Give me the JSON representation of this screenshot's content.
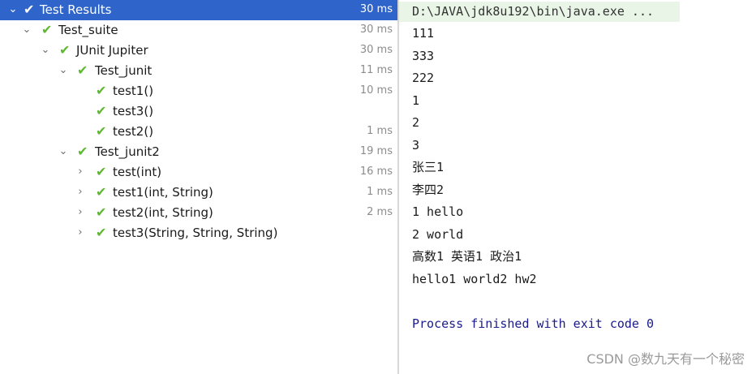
{
  "tree": [
    {
      "label": "Test Results",
      "time": "30 ms",
      "selected": true,
      "chevron": "down"
    },
    {
      "label": "Test_suite",
      "time": "30 ms",
      "chevron": "down"
    },
    {
      "label": "JUnit Jupiter",
      "time": "30 ms",
      "chevron": "down"
    },
    {
      "label": "Test_junit",
      "time": "11 ms",
      "chevron": "down"
    },
    {
      "label": "test1()",
      "time": "10 ms"
    },
    {
      "label": "test3()",
      "time": ""
    },
    {
      "label": "test2()",
      "time": "1 ms"
    },
    {
      "label": "Test_junit2",
      "time": "19 ms",
      "chevron": "down"
    },
    {
      "label": "test(int)",
      "time": "16 ms",
      "chevron": "right"
    },
    {
      "label": "test1(int, String)",
      "time": "1 ms",
      "chevron": "right"
    },
    {
      "label": "test2(int, String)",
      "time": "2 ms",
      "chevron": "right"
    },
    {
      "label": "test3(String, String, String)",
      "time": "",
      "chevron": "right"
    }
  ],
  "console": {
    "command": "D:\\JAVA\\jdk8u192\\bin\\java.exe ...",
    "lines": [
      "111",
      "333",
      "222",
      "1",
      "2",
      "3",
      "张三1",
      "李四2",
      "1 hello",
      "2 world",
      "高数1 英语1 政治1",
      "hello1 world2 hw2"
    ],
    "finish": "Process finished with exit code 0"
  },
  "watermark": "CSDN @数九天有一个秘密",
  "icons": {
    "status": "check-icon",
    "expand": "chevron-down-icon",
    "collapse": "chevron-right-icon"
  },
  "colors": {
    "selection": "#2f65ca",
    "pass": "#5fb832",
    "command_bg": "#e9f5e6",
    "finish_text": "#1a1a8c"
  }
}
